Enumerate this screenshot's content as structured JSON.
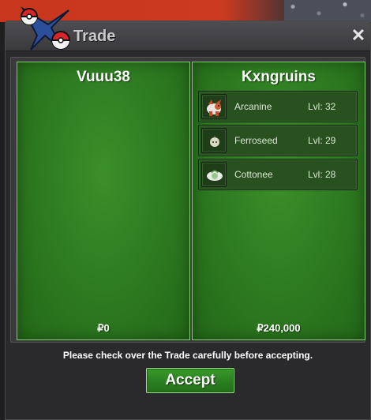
{
  "window": {
    "title": "Trade",
    "close_glyph": "✕"
  },
  "left_panel": {
    "name": "Vuuu38",
    "money": "₽0"
  },
  "right_panel": {
    "name": "Kxngruins",
    "money": "₽240,000",
    "pokemon": [
      {
        "name": "Arcanine",
        "level": "Lvl: 32",
        "icon": "arcanine-sprite-icon"
      },
      {
        "name": "Ferroseed",
        "level": "Lvl: 29",
        "icon": "ferroseed-sprite-icon"
      },
      {
        "name": "Cottonee",
        "level": "Lvl: 28",
        "icon": "cottonee-sprite-icon"
      }
    ]
  },
  "footer": {
    "notice": "Please check over the Trade carefully before accepting.",
    "accept_label": "Accept"
  },
  "colors": {
    "panel_green": "#2f7d22",
    "panel_border": "#7fd26a",
    "accept_green": "#2a7f20"
  }
}
